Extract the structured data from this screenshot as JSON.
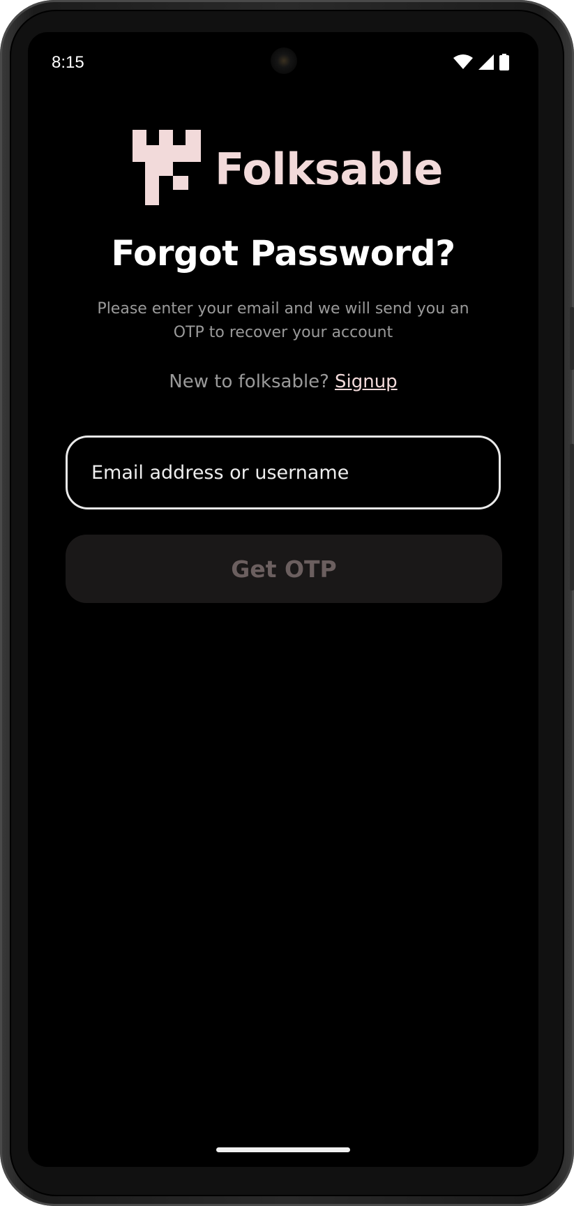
{
  "status_bar": {
    "time": "8:15"
  },
  "brand": {
    "name": "Folksable",
    "color": "#f2dada",
    "logo_icon": "castle-tower-logo"
  },
  "header": {
    "title": "Forgot Password?",
    "subtitle": "Please enter your email and we will send you an OTP to recover your account"
  },
  "signup": {
    "prompt": "New to folksable?",
    "link_label": "Signup"
  },
  "form": {
    "email_placeholder": "Email address or username",
    "email_value": "",
    "submit_label": "Get OTP"
  },
  "colors": {
    "background": "#000000",
    "accent": "#f2dada",
    "muted_text": "#9a9a9a",
    "button_bg": "#1a1818",
    "button_text": "#6b5f5f"
  }
}
